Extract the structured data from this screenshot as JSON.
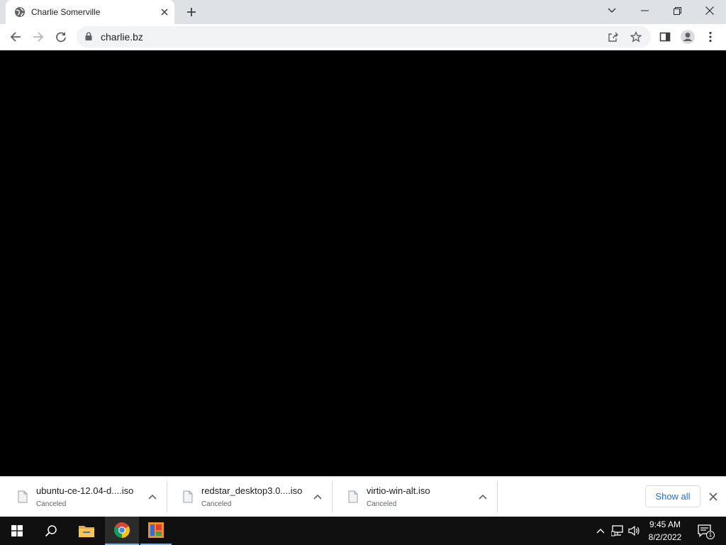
{
  "browser": {
    "tab": {
      "title": "Charlie Somerville",
      "favicon": "globe-icon"
    },
    "window_controls": [
      "tab-search-icon",
      "minimize-icon",
      "restore-icon",
      "close-icon"
    ],
    "omnibox": {
      "url": "charlie.bz",
      "security_icon": "lock-icon"
    }
  },
  "downloads": {
    "items": [
      {
        "name": "ubuntu-ce-12.04-d....iso",
        "status": "Canceled"
      },
      {
        "name": "redstar_desktop3.0....iso",
        "status": "Canceled"
      },
      {
        "name": "virtio-win-alt.iso",
        "status": "Canceled"
      }
    ],
    "show_all_label": "Show all"
  },
  "taskbar": {
    "clock": {
      "time": "9:45 AM",
      "date": "8/2/2022"
    },
    "notification_count": "1",
    "apps": [
      "start-icon",
      "search-icon",
      "file-explorer-icon",
      "chrome-icon",
      "app-icon"
    ]
  },
  "colors": {
    "tabstrip": "#dee1e6",
    "accent": "#1a73e8",
    "taskbar": "#101010"
  }
}
